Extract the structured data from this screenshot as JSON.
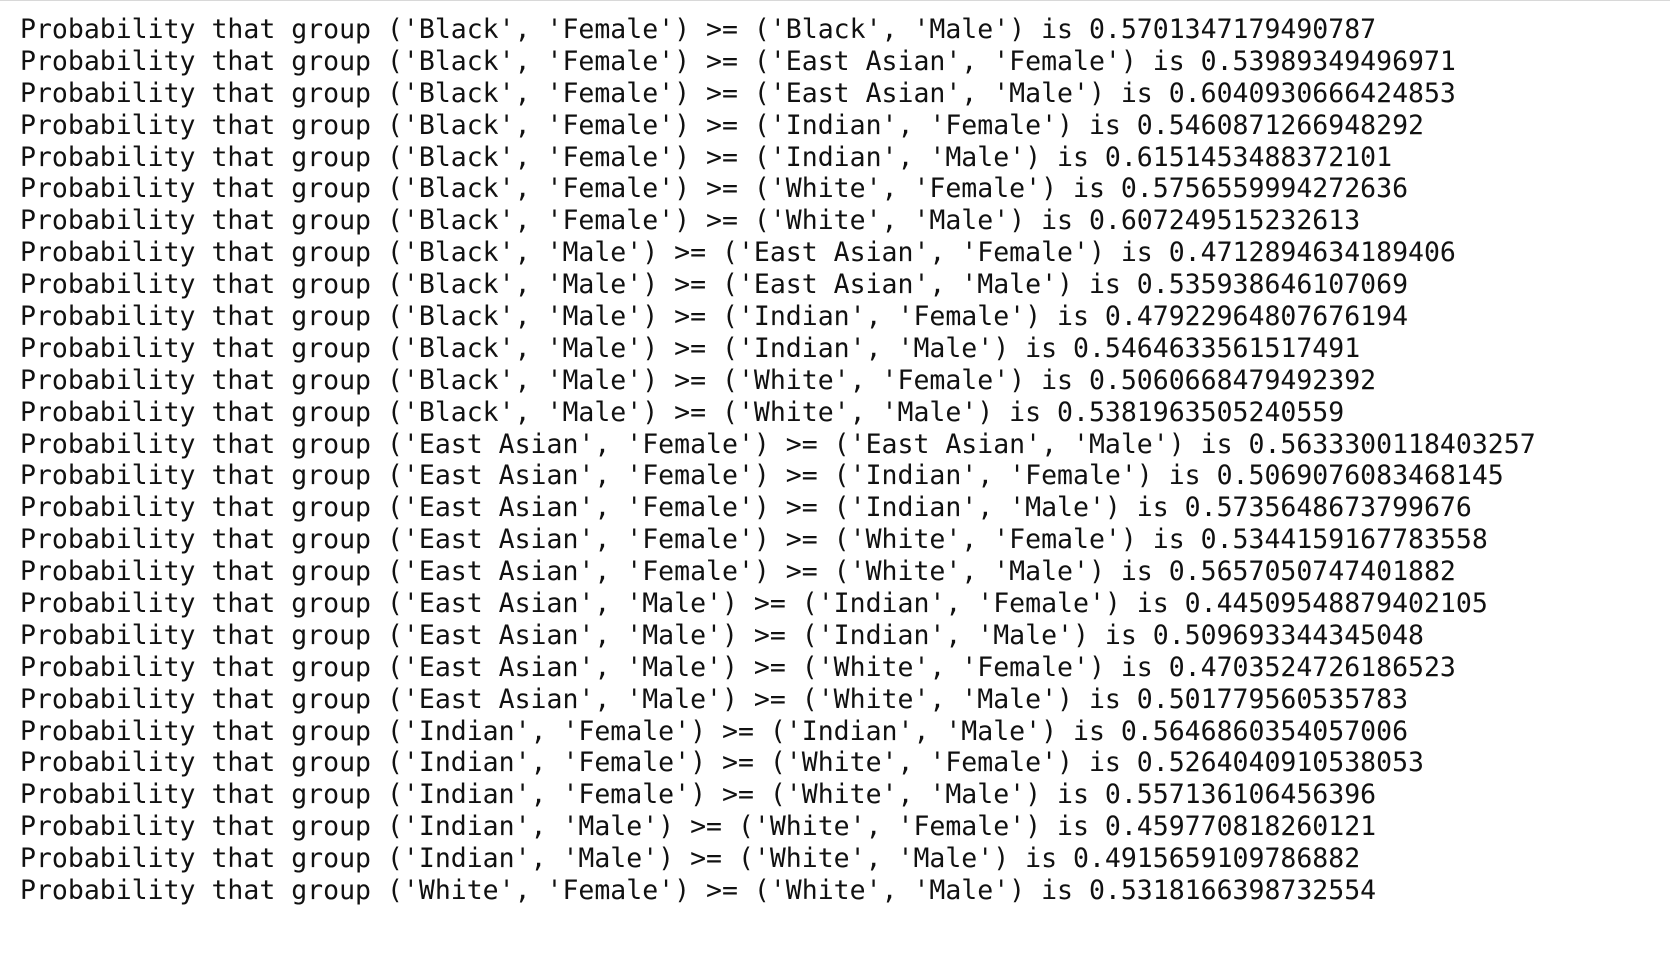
{
  "output_lines": [
    "Probability that group ('Black', 'Female') >= ('Black', 'Male') is 0.5701347179490787",
    "Probability that group ('Black', 'Female') >= ('East Asian', 'Female') is 0.53989349496971",
    "Probability that group ('Black', 'Female') >= ('East Asian', 'Male') is 0.6040930666424853",
    "Probability that group ('Black', 'Female') >= ('Indian', 'Female') is 0.5460871266948292",
    "Probability that group ('Black', 'Female') >= ('Indian', 'Male') is 0.6151453488372101",
    "Probability that group ('Black', 'Female') >= ('White', 'Female') is 0.5756559994272636",
    "Probability that group ('Black', 'Female') >= ('White', 'Male') is 0.607249515232613",
    "Probability that group ('Black', 'Male') >= ('East Asian', 'Female') is 0.4712894634189406",
    "Probability that group ('Black', 'Male') >= ('East Asian', 'Male') is 0.535938646107069",
    "Probability that group ('Black', 'Male') >= ('Indian', 'Female') is 0.47922964807676194",
    "Probability that group ('Black', 'Male') >= ('Indian', 'Male') is 0.5464633561517491",
    "Probability that group ('Black', 'Male') >= ('White', 'Female') is 0.5060668479492392",
    "Probability that group ('Black', 'Male') >= ('White', 'Male') is 0.5381963505240559",
    "Probability that group ('East Asian', 'Female') >= ('East Asian', 'Male') is 0.5633300118403257",
    "Probability that group ('East Asian', 'Female') >= ('Indian', 'Female') is 0.5069076083468145",
    "Probability that group ('East Asian', 'Female') >= ('Indian', 'Male') is 0.5735648673799676",
    "Probability that group ('East Asian', 'Female') >= ('White', 'Female') is 0.5344159167783558",
    "Probability that group ('East Asian', 'Female') >= ('White', 'Male') is 0.5657050747401882",
    "Probability that group ('East Asian', 'Male') >= ('Indian', 'Female') is 0.44509548879402105",
    "Probability that group ('East Asian', 'Male') >= ('Indian', 'Male') is 0.509693344345048",
    "Probability that group ('East Asian', 'Male') >= ('White', 'Female') is 0.4703524726186523",
    "Probability that group ('East Asian', 'Male') >= ('White', 'Male') is 0.501779560535783",
    "Probability that group ('Indian', 'Female') >= ('Indian', 'Male') is 0.5646860354057006",
    "Probability that group ('Indian', 'Female') >= ('White', 'Female') is 0.5264040910538053",
    "Probability that group ('Indian', 'Female') >= ('White', 'Male') is 0.557136106456396",
    "Probability that group ('Indian', 'Male') >= ('White', 'Female') is 0.459770818260121",
    "Probability that group ('Indian', 'Male') >= ('White', 'Male') is 0.4915659109786882",
    "Probability that group ('White', 'Female') >= ('White', 'Male') is 0.5318166398732554"
  ]
}
